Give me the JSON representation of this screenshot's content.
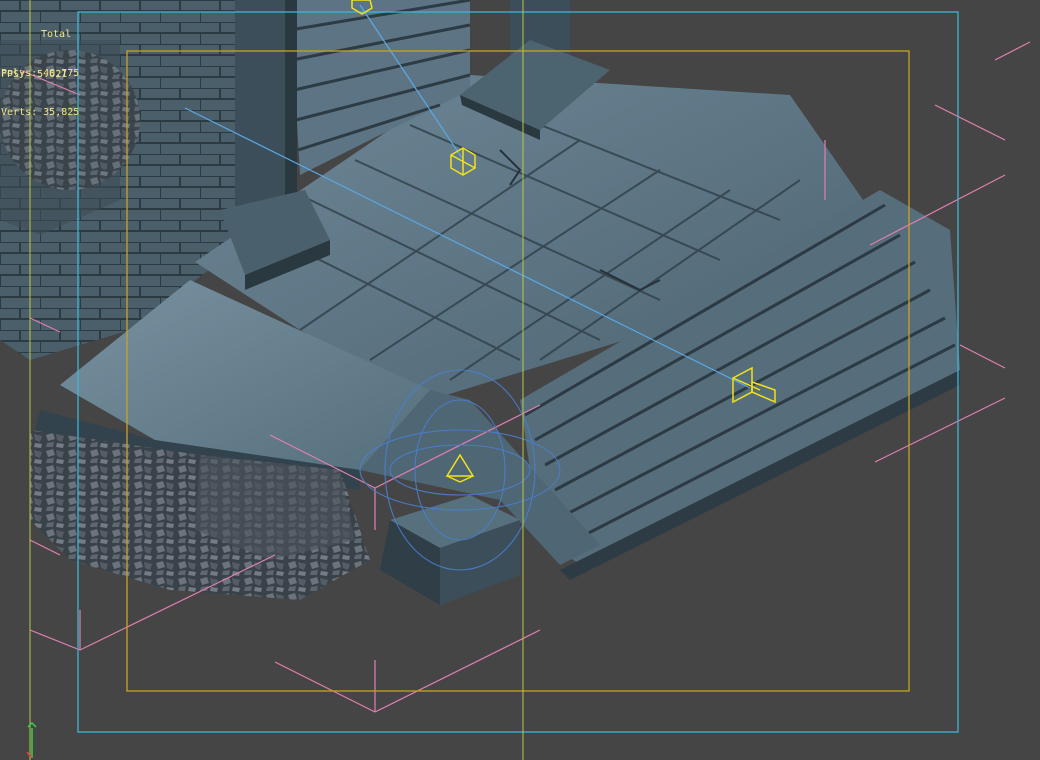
{
  "viewport": {
    "stats": {
      "title": "Total",
      "polys_label": "Polys:",
      "polys_value": "40,775",
      "verts_label": "Verts:",
      "verts_value": "35,825"
    },
    "fps": {
      "label": "FPS:",
      "value": "5.621"
    },
    "colors": {
      "background": "#454545",
      "safe_frame_outer": "#3fb5d6",
      "safe_frame_inner": "#c9a227",
      "center_guide": "#b8c845",
      "bounding_box": "#e07fb0",
      "light_helper": "#f2e21a",
      "target_line": "#5aa9e6",
      "stats_text": "#f0e68c"
    },
    "icons": [
      "omni-light-icon",
      "target-light-icon",
      "spot-light-icon",
      "axis-gizmo-icon"
    ]
  }
}
